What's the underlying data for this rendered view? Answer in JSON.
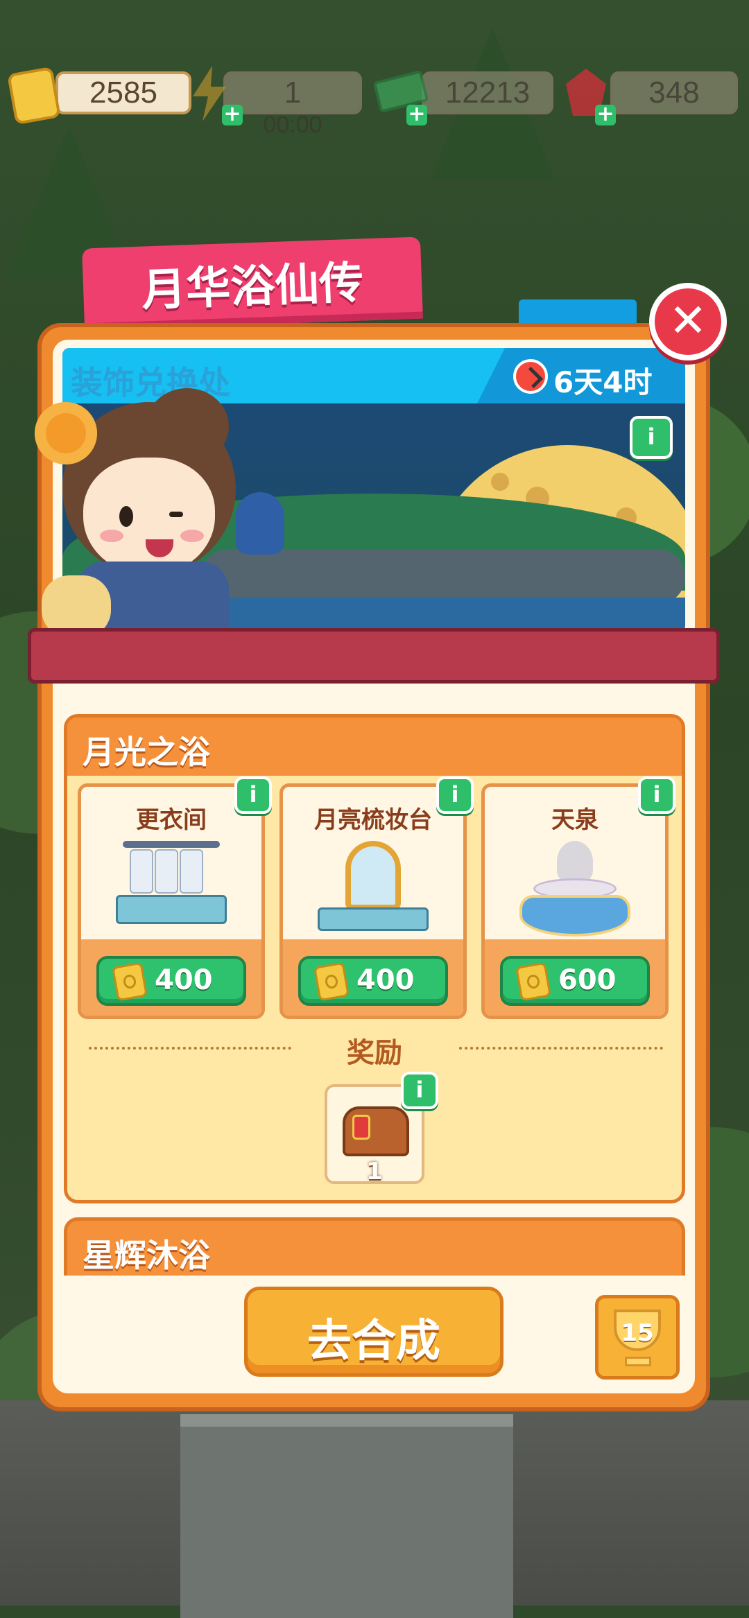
{
  "currencies": [
    {
      "name": "ticket",
      "value": "2585"
    },
    {
      "name": "energy",
      "value": "1",
      "timer": "00:00"
    },
    {
      "name": "cash",
      "value": "12213"
    },
    {
      "name": "gem",
      "value": "348"
    }
  ],
  "event": {
    "title": "月华浴仙传",
    "banner_label": "装饰兑换处",
    "countdown": "6天4时"
  },
  "section1": {
    "title": "月光之浴",
    "items": [
      {
        "name": "更衣间",
        "price": "400",
        "icon": "wardrobe-icon"
      },
      {
        "name": "月亮梳妆台",
        "price": "400",
        "icon": "vanity-icon"
      },
      {
        "name": "天泉",
        "price": "600",
        "icon": "fountain-icon"
      }
    ],
    "reward_label": "奖励",
    "reward_qty": "1"
  },
  "section2": {
    "title": "星辉沐浴"
  },
  "actions": {
    "merge_label": "去合成",
    "trophy_count": "15"
  },
  "colors": {
    "panel_orange": "#f08a2e",
    "title_pink": "#ef3f6e",
    "price_green": "#2fc26e",
    "close_red": "#e8394b",
    "banner_cyan": "#16c0f2"
  }
}
